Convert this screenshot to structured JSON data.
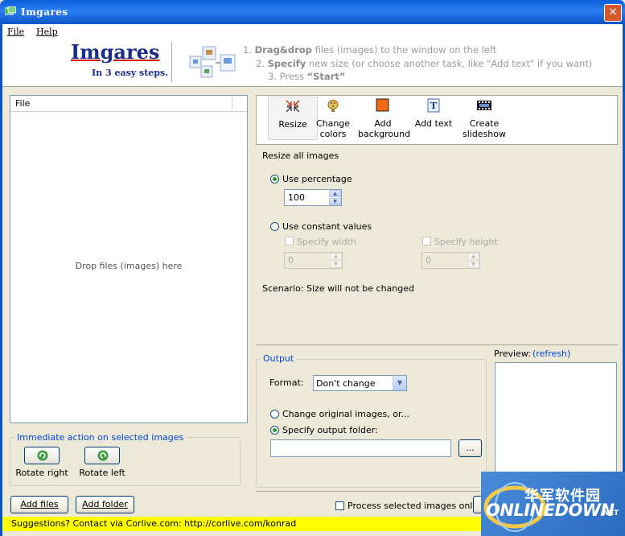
{
  "window": {
    "title": "Imgares",
    "close_glyph": "✕"
  },
  "menu": {
    "file": "File",
    "help": "Help"
  },
  "logo": {
    "name": "Imgares",
    "tagline": "In 3 easy steps."
  },
  "steps": {
    "step1_num": "1.",
    "step1_bold": "Drag&drop",
    "step1_rest": " files (images)  to the window on the left",
    "step2_num": "2.",
    "step2_bold": "Specify",
    "step2_rest": " new size (or choose another task, like \"Add text\" if you want)",
    "step3_num": "3. Press ",
    "step3_bold": "“Start”"
  },
  "file_list": {
    "column_header": "File",
    "drop_hint": "Drop files (images) here"
  },
  "immediate_actions": {
    "group_label": "Immediate action on selected images",
    "rotate_right": "Rotate right",
    "rotate_left": "Rotate left"
  },
  "buttons": {
    "add_files": "Add files",
    "add_folder": "Add folder",
    "browse": "..."
  },
  "tools": [
    {
      "label": "Resize",
      "icon": "resize-icon"
    },
    {
      "label": "Change colors",
      "icon": "palette-icon"
    },
    {
      "label": "Add background",
      "icon": "background-icon"
    },
    {
      "label": "Add text",
      "icon": "text-icon"
    },
    {
      "label": "Create slideshow",
      "icon": "film-icon"
    }
  ],
  "tool_labels": {
    "resize": "Resize",
    "change1": "Change",
    "change2": "colors",
    "add_bg1": "Add",
    "add_bg2": "background",
    "add_text": "Add text",
    "slideshow1": "Create",
    "slideshow2": "slideshow"
  },
  "resize": {
    "heading": "Resize all images",
    "use_percentage": "Use percentage",
    "percentage_value": "100",
    "use_constant": "Use constant values",
    "specify_width": "Specify width",
    "width_value": "0",
    "specify_height": "Specify height",
    "height_value": "0",
    "scenario": "Scenario: Size will not be changed",
    "selected_mode": "percentage"
  },
  "output": {
    "group_label": "Output",
    "format_label": "Format:",
    "format_value": "Don't change",
    "change_original": "Change original images, or...",
    "specify_folder": "Specify output folder:",
    "folder_value": "",
    "selected_mode": "folder"
  },
  "preview": {
    "label": "Preview:",
    "refresh_link": "(refresh)"
  },
  "process_selected_only": {
    "label": "Process selected images only",
    "checked": false
  },
  "status": {
    "text": "Suggestions? Contact via Corlive.com: http://corlive.com/konrad"
  },
  "watermark": {
    "chinese": "华军软件园",
    "english": "ONLINEDOWN",
    "suffix": ".NET"
  },
  "colors": {
    "titlebar": "#0a5fd8",
    "accent_blue": "#0046d5",
    "status_bg": "#ffff00",
    "logo_blue": "#1a2d8c"
  }
}
